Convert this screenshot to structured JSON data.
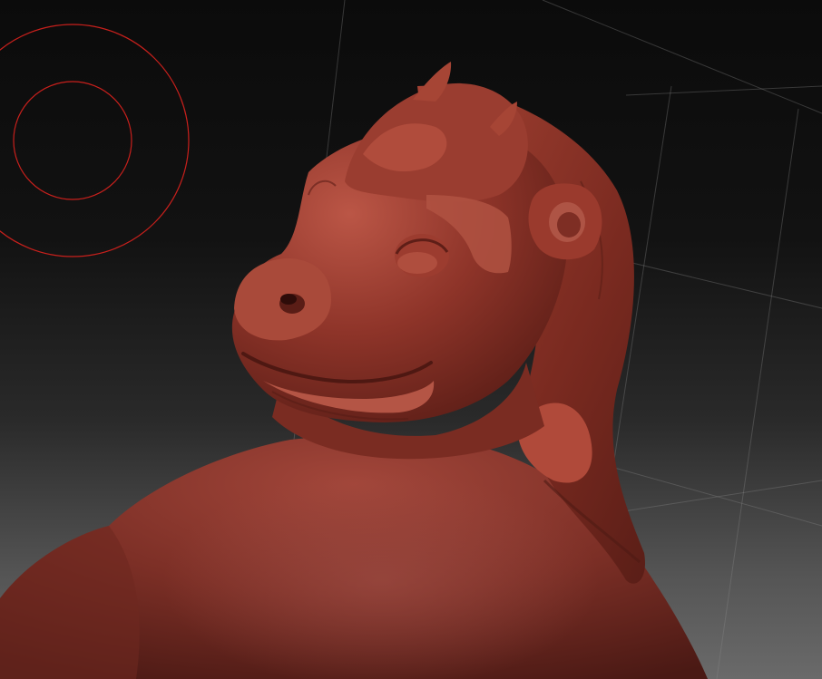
{
  "viewport": {
    "background_top": "#0b0b0b",
    "background_bottom": "#6a6a6a",
    "model_color": "#8a3328",
    "grid_color": "#8a8a8a"
  },
  "brush_cursor": {
    "color": "#c8201c",
    "icon": "brush-radius-rings"
  }
}
